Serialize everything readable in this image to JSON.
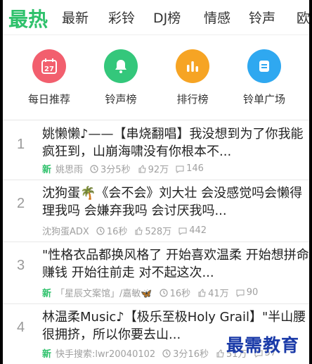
{
  "tabs": [
    "最热",
    "最新",
    "彩铃",
    "DJ榜",
    "情感",
    "铃声",
    "欧"
  ],
  "shortcuts": [
    {
      "label": "每日推荐",
      "icon": "calendar-icon",
      "color": "#f25f6e",
      "calendar_day": "27"
    },
    {
      "label": "铃声榜",
      "icon": "bell-icon",
      "color": "#34c77b"
    },
    {
      "label": "排行榜",
      "icon": "bar-chart-icon",
      "color": "#f6a424"
    },
    {
      "label": "铃单广场",
      "icon": "list-icon",
      "color": "#2fa8f0"
    }
  ],
  "songs": [
    {
      "rank": "1",
      "title": "姚懒懒♪——【串烧翻唱】我没想到为了你我能疯狂到，山崩海啸没有你根本不...",
      "is_new": true,
      "new_label": "新",
      "author": "姚思雨",
      "duration": "3分5秒",
      "likes": "92万",
      "comments": "146"
    },
    {
      "rank": "2",
      "title": "沈狗蛋🌴《会不会》刘大壮 会没感觉吗会懒得理我吗 会嫌弃我吗 会讨厌我吗...",
      "is_new": false,
      "new_label": "",
      "author": "沈狗蛋ADX",
      "duration": "16秒",
      "likes": "528万",
      "comments": "442"
    },
    {
      "rank": "3",
      "title": "\"性格衣品都换风格了 开始喜欢温柔 开始想拼命赚钱  开始往前走 对不起这次...",
      "is_new": true,
      "new_label": "新",
      "author": "「星辰文案馆」/嘉敏🦋",
      "duration": "16秒",
      "likes": "41万",
      "comments": "90"
    },
    {
      "rank": "4",
      "title": "林温柔Music♪【极乐至极Holy Grail】\"半山腰很拥挤，所以你要去山...",
      "is_new": true,
      "new_label": "新",
      "author": "快手搜索:lwr20040102",
      "duration": "3分16秒",
      "likes": "51万",
      "comments": "57"
    }
  ],
  "watermark": "最需教育",
  "colors": {
    "accent": "#2ec16b",
    "meta": "#a0a0a0",
    "watermark": "#1a3aa8"
  }
}
